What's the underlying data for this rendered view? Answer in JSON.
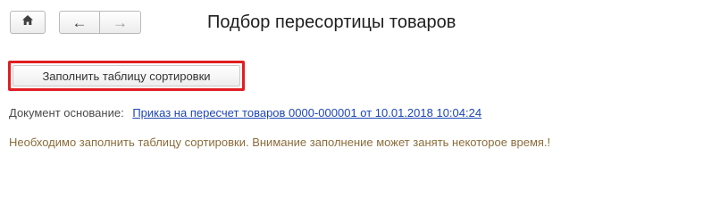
{
  "toolbar": {
    "home_icon": "home-icon",
    "back_icon": "arrow-left-icon",
    "forward_icon": "arrow-right-icon"
  },
  "form": {
    "title": "Подбор пересортицы товаров"
  },
  "actions": {
    "fill_button_label": "Заполнить таблицу сортировки",
    "highlight_color": "#e01e22"
  },
  "document": {
    "label": "Документ основание:",
    "link_text": "Приказ на пересчет товаров 0000-000001 от 10.01.2018 10:04:24"
  },
  "notice": {
    "text": "Необходимо заполнить таблицу сортировки. Внимание заполнение может занять некоторое время.!"
  }
}
